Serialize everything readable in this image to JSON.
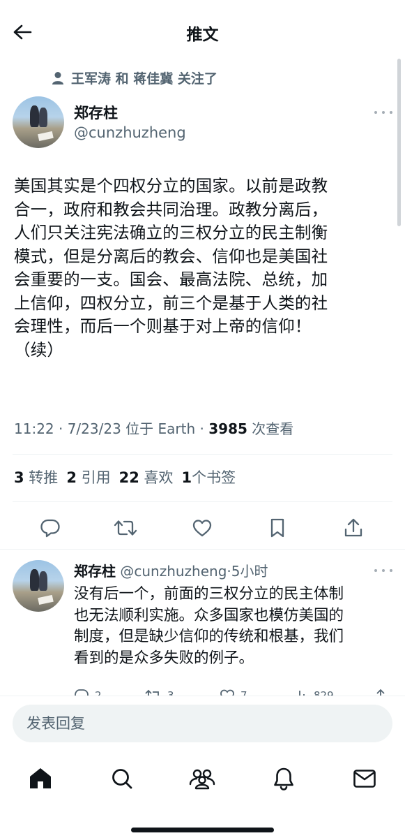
{
  "header": {
    "title": "推文",
    "back_icon": "arrow-left-icon"
  },
  "social_context": {
    "icon": "person-icon",
    "text": "王军涛 和 蒋佳冀 关注了"
  },
  "tweet": {
    "author_name": "郑存柱",
    "author_handle": "@cunzhuzheng",
    "text": "美国其实是个四权分立的国家。以前是政教\n合一，政府和教会共同治理。政教分离后，\n人们只关注宪法确立的三权分立的民主制衡\n模式，但是分离后的教会、信仰也是美国社\n会重要的一支。国会、最高法院、总统，加\n上信仰，四权分立，前三个是基于人类的社\n会理性，而后一个则基于对上帝的信仰！\n（续）",
    "meta_prefix": "11:22 · 7/23/23 位于 Earth · ",
    "views_count": "3985",
    "views_label": " 次查看",
    "stats": {
      "retweets_count": "3",
      "retweets_label": " 转推",
      "quotes_count": "2",
      "quotes_label": " 引用",
      "likes_count": "22",
      "likes_label": " 喜欢",
      "bookmarks_count": "1",
      "bookmarks_label": "个书签"
    },
    "actions": [
      "reply-icon",
      "retweet-icon",
      "like-icon",
      "bookmark-icon",
      "share-icon"
    ]
  },
  "reply": {
    "author_name": "郑存柱",
    "handle_time": "@cunzhuzheng·5小时",
    "text": "没有后一个，前面的三权分立的民主体制\n也无法顺利实施。众多国家也模仿美国的\n制度，但是缺少信仰的传统和根基，我们\n看到的是众多失败的例子。",
    "reply_count": "2",
    "retweet_count": "3",
    "like_count": "7",
    "views_count": "829"
  },
  "composer": {
    "placeholder": "发表回复"
  },
  "tabbar": [
    "home-icon",
    "search-icon",
    "communities-icon",
    "notifications-icon",
    "messages-icon"
  ],
  "colors": {
    "text": "#0f1419",
    "secondary": "#536471",
    "divider": "#eff3f4",
    "input_bg": "#eff3f4"
  }
}
